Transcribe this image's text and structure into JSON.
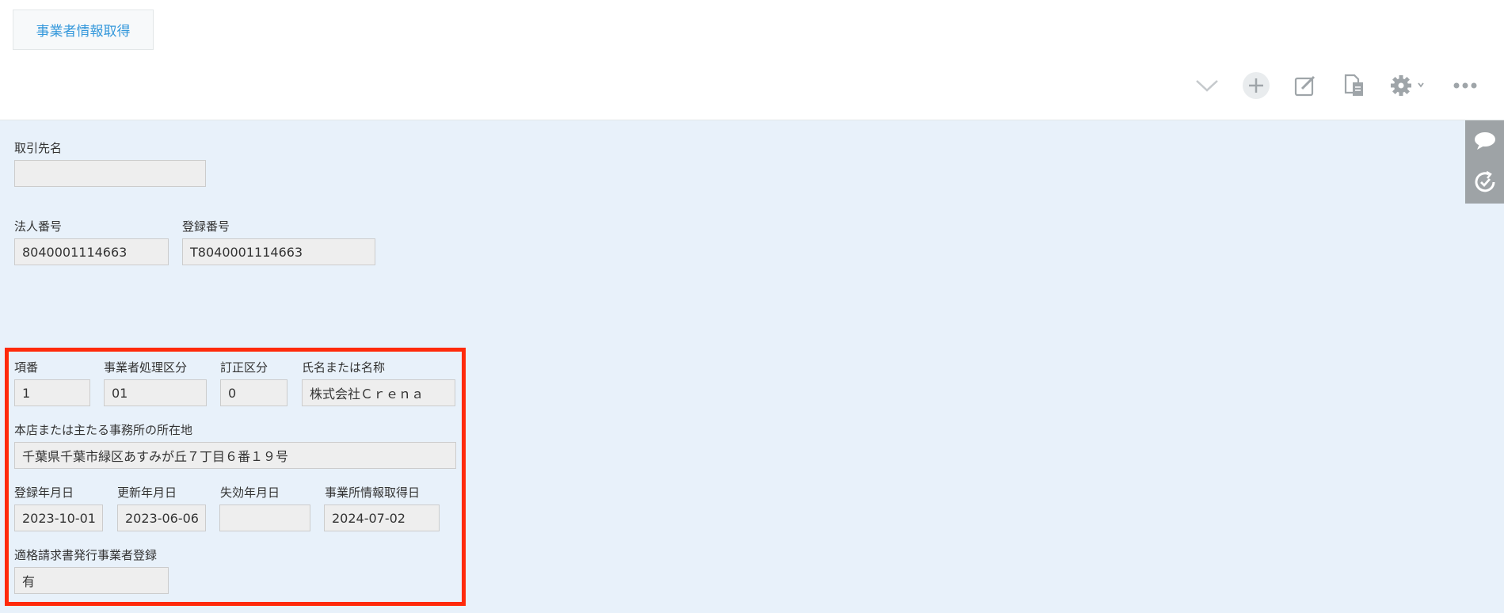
{
  "header": {
    "action_button_label": "事業者情報取得"
  },
  "toolbar": {
    "icons": [
      "chevron-down-icon",
      "plus-icon",
      "edit-icon",
      "duplicate-icon",
      "gear-icon",
      "more-icon"
    ]
  },
  "record": {
    "torihikisaki": {
      "label": "取引先名",
      "value": ""
    },
    "houjin_bangou": {
      "label": "法人番号",
      "value": "8040001114663"
    },
    "touroku_bangou": {
      "label": "登録番号",
      "value": "T8040001114663"
    }
  },
  "group": {
    "kouban": {
      "label": "項番",
      "value": "1"
    },
    "shori_kubun": {
      "label": "事業者処理区分",
      "value": "01"
    },
    "teisei_kubun": {
      "label": "訂正区分",
      "value": "0"
    },
    "shimei": {
      "label": "氏名または名称",
      "value": "株式会社Ｃｒｅｎａ"
    },
    "shozaichi": {
      "label": "本店または主たる事務所の所在地",
      "value": "千葉県千葉市緑区あすみが丘７丁目６番１９号"
    },
    "touroku_date": {
      "label": "登録年月日",
      "value": "2023-10-01"
    },
    "koushin_date": {
      "label": "更新年月日",
      "value": "2023-06-06"
    },
    "shikkou_date": {
      "label": "失効年月日",
      "value": ""
    },
    "shutoku_date": {
      "label": "事業所情報取得日",
      "value": "2024-07-02"
    },
    "tekikaku": {
      "label": "適格請求書発行事業者登録",
      "value": "有"
    }
  },
  "colors": {
    "highlight": "#ff2a0a",
    "accent": "#3498db",
    "background": "#e8f1fa"
  }
}
